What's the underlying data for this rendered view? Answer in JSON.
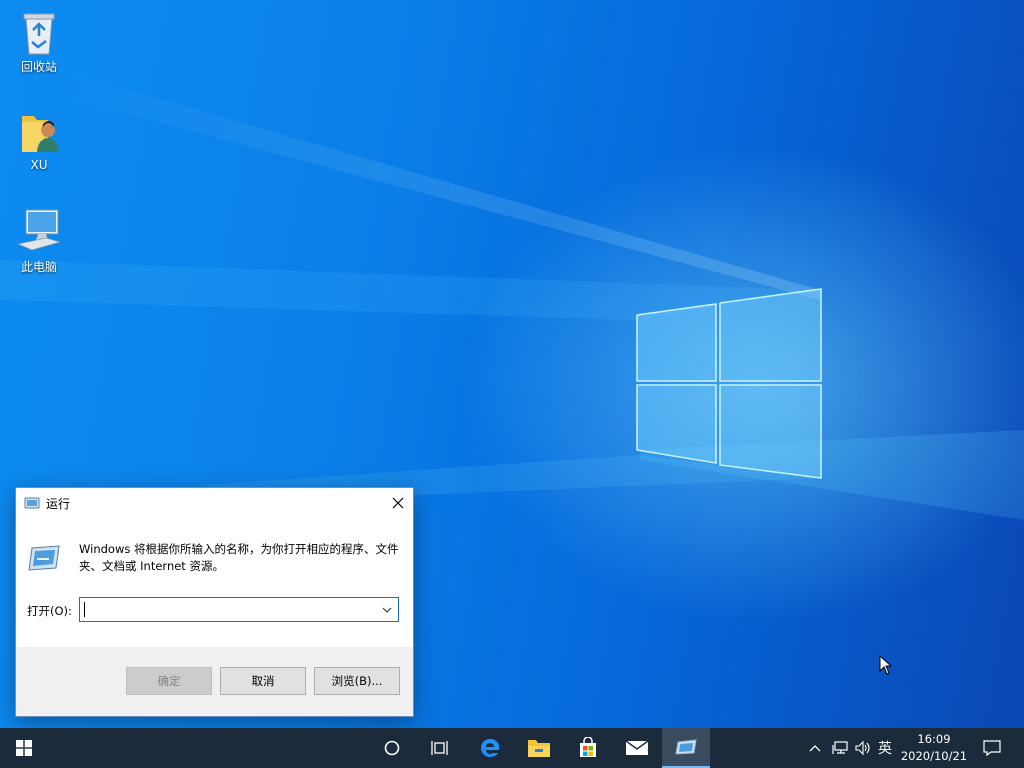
{
  "desktop": {
    "icons": [
      {
        "label": "回收站",
        "icon": "recycle-bin-icon"
      },
      {
        "label": "XU",
        "icon": "user-folder-icon"
      },
      {
        "label": "此电脑",
        "icon": "computer-icon"
      }
    ]
  },
  "run_dialog": {
    "title": "运行",
    "description": "Windows 将根据你所输入的名称，为你打开相应的程序、文件夹、文档或 Internet 资源。",
    "open_label": "打开(O):",
    "open_value": "",
    "buttons": {
      "ok": "确定",
      "cancel": "取消",
      "browse": "浏览(B)..."
    }
  },
  "taskbar": {
    "items": [
      "start-icon",
      "cortana-icon",
      "task-view-icon",
      "edge-icon",
      "file-explorer-icon",
      "store-icon",
      "mail-icon",
      "run-icon"
    ],
    "tray": {
      "language": "英",
      "time": "16:09",
      "date": "2020/10/21"
    }
  },
  "colors": {
    "accent": "#0f73c8",
    "taskbar": "#1b2b3c"
  }
}
